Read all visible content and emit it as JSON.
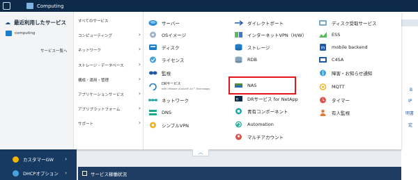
{
  "topbar": {
    "service_label": "Computing"
  },
  "menu": {
    "recent_header": "最近利用したサービス",
    "recent_items": [
      "computing"
    ],
    "all_services_link": "サービス一覧へ",
    "categories": [
      "すべてのサービス",
      "コンピューティング",
      "ネットワーク",
      "ストレージ・データベース",
      "構成・運用・管理",
      "アプリケーションサービス",
      "アプリプラットフォーム",
      "サポート"
    ],
    "services_col1": [
      {
        "label": "サーバー",
        "icon": "server-icon"
      },
      {
        "label": "OSイメージ",
        "icon": "os-image-icon"
      },
      {
        "label": "ディスク",
        "icon": "disk-icon"
      },
      {
        "label": "ライセンス",
        "icon": "license-icon"
      },
      {
        "label": "監視",
        "icon": "monitoring-eye-icon"
      },
      {
        "label": "DRサービス",
        "sub": "with VMware vCloud® Air™ Technology",
        "icon": "dr-service-icon"
      },
      {
        "label": "ネットワーク",
        "icon": "network-icon"
      },
      {
        "label": "DNS",
        "icon": "dns-icon"
      },
      {
        "label": "シンプルVPN",
        "icon": "simple-vpn-icon"
      }
    ],
    "services_col2": [
      {
        "label": "ダイレクトポート",
        "icon": "direct-port-icon"
      },
      {
        "label": "インターネットVPN（H/W）",
        "icon": "internet-vpn-icon"
      },
      {
        "label": "ストレージ",
        "icon": "storage-icon"
      },
      {
        "label": "RDB",
        "icon": "rdb-icon"
      },
      {
        "label": "NAS",
        "icon": "nas-icon"
      },
      {
        "label": "DRサービス for NetApp",
        "icon": "dr-netapp-icon"
      },
      {
        "label": "青有コンポーネント",
        "icon": "component-icon"
      },
      {
        "label": "Automation",
        "icon": "automation-icon"
      },
      {
        "label": "マルチアカウント",
        "icon": "multi-account-icon"
      }
    ],
    "services_col3": [
      {
        "label": "ディスク受取サービス",
        "icon": "disk-receive-icon"
      },
      {
        "label": "ESS",
        "icon": "ess-icon"
      },
      {
        "label": "mobile backend",
        "icon": "mobile-backend-icon"
      },
      {
        "label": "C4SA",
        "icon": "c4sa-icon"
      },
      {
        "label": "障害・お知らせ通知",
        "icon": "info-icon"
      },
      {
        "label": "MQTT",
        "icon": "mqtt-icon"
      },
      {
        "label": "タイマー",
        "icon": "timer-icon"
      },
      {
        "label": "有人監視",
        "icon": "manned-monitoring-icon"
      }
    ]
  },
  "leftnav": {
    "items": [
      {
        "label": "カスタマーGW",
        "icon": "customer-gw-icon"
      },
      {
        "label": "DHCPオプション",
        "icon": "dhcp-option-icon"
      }
    ]
  },
  "statusbar": {
    "label": "サービス稼働状況"
  },
  "bg_fragments": [
    "B",
    "IP",
    "明書",
    "定"
  ],
  "colors": {
    "highlight": "#e3151b",
    "topbar": "#0d2a4a",
    "nav": "#173a62"
  }
}
